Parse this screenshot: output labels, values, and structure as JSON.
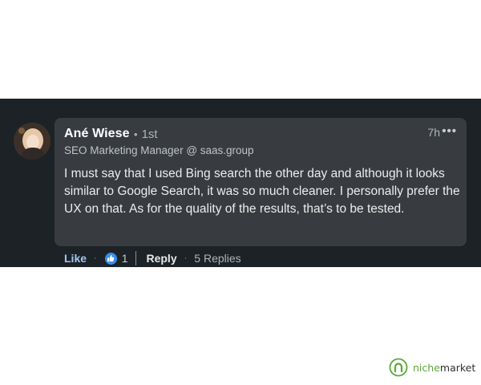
{
  "comment": {
    "author_name": "Ané Wiese",
    "connection_degree": "1st",
    "dot": "•",
    "headline": "SEO Marketing Manager @ saas.group",
    "time": "7h",
    "more_label": "•••",
    "text": "I must say that I used Bing search the other day and although it looks similar to Google Search, it was so much cleaner. I personally prefer the UX on that. As for the quality of the results, that’s to be tested."
  },
  "actions": {
    "like_label": "Like",
    "sep": "·",
    "reaction_icon": "thumbs-up-icon",
    "reaction_count": "1",
    "reply_label": "Reply",
    "replies_label": "5 Replies"
  },
  "brand": {
    "name_prefix": "niche",
    "name_suffix": "market",
    "icon": "nichemarket-logo-icon",
    "color": "#5aa637"
  },
  "colors": {
    "panel_bg": "#1d2226",
    "bubble_bg": "#383c41",
    "like_blue": "#9fc6f5",
    "reaction_blue": "#378fe9"
  }
}
